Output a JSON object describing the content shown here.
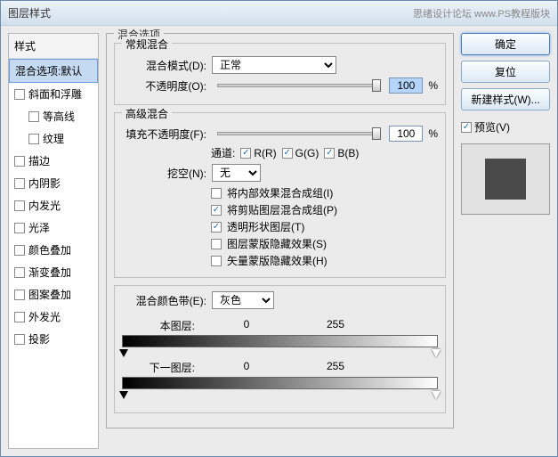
{
  "window": {
    "title": "图层样式",
    "watermark": "思绪设计论坛 www.PS教程版块"
  },
  "left": {
    "header": "样式",
    "items": [
      {
        "label": "混合选项:默认",
        "selected": true,
        "checkbox": false
      },
      {
        "label": "斜面和浮雕",
        "checkbox": true,
        "checked": false
      },
      {
        "label": "等高线",
        "checkbox": true,
        "checked": false,
        "indent": true
      },
      {
        "label": "纹理",
        "checkbox": true,
        "checked": false,
        "indent": true
      },
      {
        "label": "描边",
        "checkbox": true,
        "checked": false
      },
      {
        "label": "内阴影",
        "checkbox": true,
        "checked": false
      },
      {
        "label": "内发光",
        "checkbox": true,
        "checked": false
      },
      {
        "label": "光泽",
        "checkbox": true,
        "checked": false
      },
      {
        "label": "颜色叠加",
        "checkbox": true,
        "checked": false
      },
      {
        "label": "渐变叠加",
        "checkbox": true,
        "checked": false
      },
      {
        "label": "图案叠加",
        "checkbox": true,
        "checked": false
      },
      {
        "label": "外发光",
        "checkbox": true,
        "checked": false
      },
      {
        "label": "投影",
        "checkbox": true,
        "checked": false
      }
    ]
  },
  "middle": {
    "group_title": "混合选项",
    "general_title": "常规混合",
    "blend_mode_label": "混合模式(D):",
    "blend_mode_value": "正常",
    "opacity_label": "不透明度(O):",
    "opacity_value": "100",
    "opacity_unit": "%",
    "advanced_title": "高级混合",
    "fill_opacity_label": "填充不透明度(F):",
    "fill_opacity_value": "100",
    "fill_opacity_unit": "%",
    "channels_label": "通道:",
    "channel_r": "R(R)",
    "channel_g": "G(G)",
    "channel_b": "B(B)",
    "knockout_label": "挖空(N):",
    "knockout_value": "无",
    "adv_checks": [
      {
        "label": "将内部效果混合成组(I)",
        "checked": false
      },
      {
        "label": "将剪贴图层混合成组(P)",
        "checked": true
      },
      {
        "label": "透明形状图层(T)",
        "checked": true
      },
      {
        "label": "图层蒙版隐藏效果(S)",
        "checked": false
      },
      {
        "label": "矢量蒙版隐藏效果(H)",
        "checked": false
      }
    ],
    "blendif_label": "混合颜色带(E):",
    "blendif_value": "灰色",
    "this_layer_label": "本图层:",
    "this_black": "0",
    "this_white": "255",
    "under_layer_label": "下一图层:",
    "under_black": "0",
    "under_white": "255"
  },
  "right": {
    "ok": "确定",
    "reset": "复位",
    "new_style": "新建样式(W)...",
    "preview": "预览(V)"
  }
}
